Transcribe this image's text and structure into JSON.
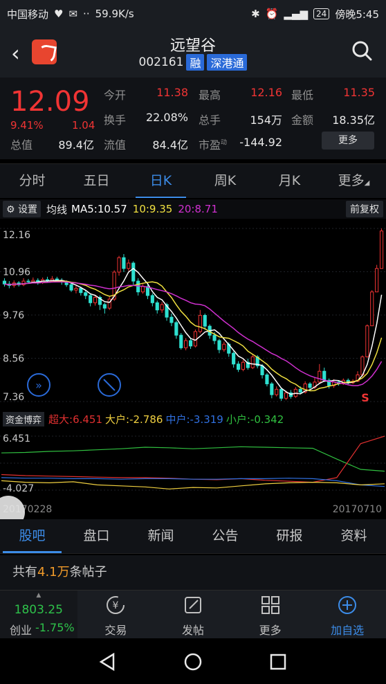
{
  "status": {
    "carrier": "中国移动",
    "speed": "59.9K/s",
    "battery": "24",
    "time": "傍晚5:45"
  },
  "header": {
    "title": "远望谷",
    "code": "002161",
    "tag1": "融",
    "tag2": "深港通"
  },
  "quote": {
    "price": "12.09",
    "change_pct": "9.41%",
    "change_abs": "1.04",
    "labels": {
      "open": "今开",
      "high": "最高",
      "low": "最低",
      "turnover": "换手",
      "volume": "总手",
      "amount": "金额",
      "total_value": "总值",
      "float_value": "流值",
      "pe": "市盈"
    },
    "values": {
      "open": "11.38",
      "high": "12.16",
      "low": "11.35",
      "turnover": "22.08%",
      "volume": "154万",
      "amount": "18.35亿",
      "total_value": "89.4亿",
      "float_value": "84.4亿",
      "pe": "-144.92"
    },
    "pe_superscript": "动",
    "more_label": "更多"
  },
  "tabs": [
    {
      "label": "分时"
    },
    {
      "label": "五日"
    },
    {
      "label": "日K"
    },
    {
      "label": "周K"
    },
    {
      "label": "月K"
    },
    {
      "label": "更多"
    }
  ],
  "chartbar": {
    "settings_label": "设置",
    "ma_label": "均线",
    "ma5": "MA5:10.57",
    "ma10": "10:9.35",
    "ma20": "20:8.71",
    "fq_label": "前复权",
    "colors": {
      "ma5": "#ffffff",
      "ma10": "#f0e040",
      "ma20": "#d030d0"
    }
  },
  "chart_data": {
    "type": "candlestick",
    "y_ticks": [
      "12.16",
      "10.96",
      "9.76",
      "8.56",
      "7.36"
    ],
    "ylim": [
      7.36,
      12.16
    ],
    "marker": "S",
    "x_start": "20170228",
    "x_end": "20170710",
    "candles": [
      [
        10.7,
        10.62,
        10.78,
        10.55
      ],
      [
        10.62,
        10.58,
        10.7,
        10.5
      ],
      [
        10.58,
        10.65,
        10.72,
        10.52
      ],
      [
        10.65,
        10.6,
        10.7,
        10.55
      ],
      [
        10.6,
        10.7,
        10.78,
        10.56
      ],
      [
        10.7,
        10.68,
        10.76,
        10.62
      ],
      [
        10.68,
        10.72,
        10.8,
        10.64
      ],
      [
        10.72,
        10.66,
        10.78,
        10.6
      ],
      [
        10.66,
        10.74,
        10.8,
        10.62
      ],
      [
        10.74,
        10.7,
        10.82,
        10.66
      ],
      [
        10.7,
        10.76,
        10.84,
        10.66
      ],
      [
        10.76,
        10.72,
        10.82,
        10.68
      ],
      [
        10.72,
        10.68,
        10.78,
        10.6
      ],
      [
        10.68,
        10.6,
        10.72,
        10.54
      ],
      [
        10.6,
        10.45,
        10.64,
        10.4
      ],
      [
        10.45,
        10.5,
        10.58,
        10.36
      ],
      [
        10.5,
        10.38,
        10.55,
        10.3
      ],
      [
        10.38,
        10.3,
        10.45,
        10.2
      ],
      [
        10.3,
        10.1,
        10.35,
        10.0
      ],
      [
        10.1,
        10.25,
        10.32,
        10.02
      ],
      [
        10.25,
        10.05,
        10.3,
        9.9
      ],
      [
        10.05,
        9.95,
        10.1,
        9.8
      ],
      [
        9.95,
        10.2,
        10.26,
        9.9
      ],
      [
        10.2,
        10.95,
        11.0,
        10.15
      ],
      [
        10.95,
        11.35,
        11.4,
        10.85
      ],
      [
        11.35,
        11.05,
        11.45,
        10.95
      ],
      [
        11.05,
        11.2,
        11.3,
        10.98
      ],
      [
        11.2,
        10.7,
        11.25,
        10.6
      ],
      [
        10.7,
        10.4,
        10.78,
        10.3
      ],
      [
        10.4,
        10.55,
        10.62,
        10.35
      ],
      [
        10.55,
        10.3,
        10.6,
        10.2
      ],
      [
        10.3,
        10.1,
        10.36,
        10.0
      ],
      [
        10.1,
        9.9,
        10.16,
        9.8
      ],
      [
        9.9,
        10.05,
        10.12,
        9.82
      ],
      [
        10.05,
        9.7,
        10.1,
        9.6
      ],
      [
        9.7,
        9.55,
        9.8,
        9.45
      ],
      [
        9.55,
        9.2,
        9.6,
        9.1
      ],
      [
        9.2,
        8.85,
        9.26,
        8.8
      ],
      [
        8.85,
        9.05,
        9.12,
        8.78
      ],
      [
        9.05,
        8.9,
        9.1,
        8.82
      ],
      [
        8.9,
        9.3,
        9.36,
        8.86
      ],
      [
        9.3,
        9.75,
        9.9,
        9.25
      ],
      [
        9.75,
        9.45,
        9.8,
        9.35
      ],
      [
        9.45,
        9.2,
        9.5,
        9.1
      ],
      [
        9.2,
        9.05,
        9.28,
        8.95
      ],
      [
        9.05,
        8.8,
        9.1,
        8.7
      ],
      [
        8.8,
        8.95,
        9.02,
        8.74
      ],
      [
        8.95,
        8.7,
        9.0,
        8.6
      ],
      [
        8.7,
        8.4,
        8.75,
        8.3
      ],
      [
        8.4,
        8.25,
        8.48,
        8.18
      ],
      [
        8.25,
        8.45,
        8.52,
        8.2
      ],
      [
        8.45,
        8.3,
        8.55,
        8.24
      ],
      [
        8.3,
        8.6,
        8.66,
        8.26
      ],
      [
        8.6,
        8.35,
        8.65,
        8.28
      ],
      [
        8.35,
        8.1,
        8.4,
        8.0
      ],
      [
        8.1,
        7.85,
        8.15,
        7.78
      ],
      [
        7.85,
        7.55,
        7.9,
        7.45
      ],
      [
        7.55,
        7.7,
        7.78,
        7.5
      ],
      [
        7.7,
        7.45,
        7.75,
        7.38
      ],
      [
        7.45,
        7.6,
        7.66,
        7.4
      ],
      [
        7.6,
        7.5,
        7.68,
        7.44
      ],
      [
        7.5,
        7.7,
        7.76,
        7.46
      ],
      [
        7.7,
        7.62,
        7.78,
        7.56
      ],
      [
        7.62,
        7.85,
        7.92,
        7.58
      ],
      [
        7.85,
        7.75,
        7.9,
        7.68
      ],
      [
        7.75,
        7.9,
        8.02,
        7.7
      ],
      [
        7.9,
        8.2,
        8.4,
        7.86
      ],
      [
        8.2,
        7.95,
        8.3,
        7.9
      ],
      [
        7.95,
        7.8,
        8.0,
        7.72
      ],
      [
        7.8,
        7.9,
        7.98,
        7.74
      ],
      [
        7.9,
        7.85,
        7.95,
        7.8
      ],
      [
        7.85,
        7.95,
        8.0,
        7.82
      ],
      [
        7.95,
        7.88,
        8.0,
        7.84
      ],
      [
        7.88,
        7.92,
        7.98,
        7.84
      ],
      [
        7.92,
        8.1,
        8.2,
        7.9
      ],
      [
        8.1,
        8.6,
        8.64,
        8.05
      ],
      [
        8.6,
        9.46,
        9.5,
        8.58
      ],
      [
        9.46,
        10.4,
        10.45,
        9.6
      ],
      [
        10.4,
        11.05,
        11.15,
        10.55
      ],
      [
        11.05,
        12.09,
        12.16,
        11.35
      ]
    ]
  },
  "flowbar": {
    "label": "资金博弈",
    "super": "超大:6.451",
    "big": "大户:-2.786",
    "mid": "中户:-3.319",
    "small": "小户:-0.342",
    "y_max": "6.451",
    "y_min": "-4.027",
    "colors": {
      "super": "#e03030",
      "big": "#f0d040",
      "mid": "#3070e0",
      "small": "#30c040"
    }
  },
  "flow_data": {
    "super": [
      -1.0,
      -1.2,
      -1.3,
      -1.4,
      -1.5,
      -1.6,
      -1.6,
      -1.7,
      -1.9,
      -2.0,
      -1.8,
      -2.1,
      -2.3,
      -2.5,
      -1.6,
      5.0,
      6.451
    ],
    "big": [
      -2.2,
      -2.5,
      -2.6,
      -2.4,
      -3.0,
      -3.2,
      -3.4,
      -3.8,
      -3.5,
      -3.6,
      -3.2,
      -2.8,
      -2.6,
      -2.5,
      -2.6,
      -3.0,
      -2.786
    ],
    "mid": [
      -1.6,
      -1.7,
      -1.7,
      -1.8,
      -1.8,
      -1.9,
      -1.8,
      -1.8,
      -1.9,
      -1.9,
      -1.8,
      -1.8,
      -1.7,
      -1.8,
      -2.2,
      -3.0,
      -3.319
    ],
    "small": [
      3.2,
      3.3,
      3.5,
      3.6,
      3.8,
      4.0,
      4.3,
      4.2,
      4.0,
      4.2,
      4.4,
      4.3,
      4.2,
      4.1,
      2.0,
      0.0,
      -0.342
    ]
  },
  "subtabs": [
    {
      "label": "股吧"
    },
    {
      "label": "盘口"
    },
    {
      "label": "新闻"
    },
    {
      "label": "公告"
    },
    {
      "label": "研报"
    },
    {
      "label": "资料"
    }
  ],
  "posts": {
    "prefix": "共有",
    "count": "4.1万",
    "suffix": "条帖子"
  },
  "bottom": {
    "index_value": "1803.25",
    "index_name": "创业",
    "index_pct": "-1.75%",
    "trade": "交易",
    "post": "发帖",
    "more": "更多",
    "add": "加自选"
  }
}
